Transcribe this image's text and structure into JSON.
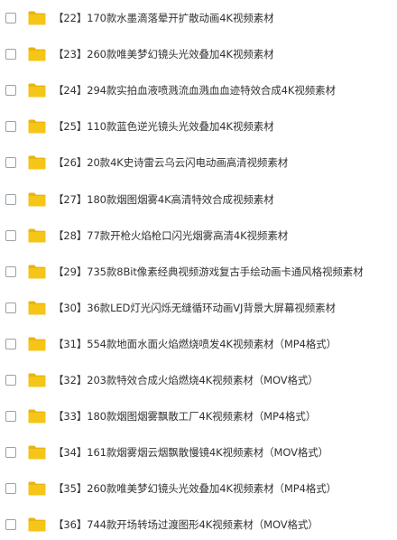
{
  "folder_color": "#F5C518",
  "folder_tab_color": "#E8B410",
  "text_color": "#333333",
  "icon": "folder-icon",
  "files": [
    {
      "name": "【22】170款水墨滴落晕开扩散动画4K视频素材"
    },
    {
      "name": "【23】260款唯美梦幻镜头光效叠加4K视频素材"
    },
    {
      "name": "【24】294款实拍血液喷溅流血溅血血迹特效合成4K视频素材"
    },
    {
      "name": "【25】110款蓝色逆光镜头光效叠加4K视频素材"
    },
    {
      "name": "【26】20款4K史诗雷云乌云闪电动画高清视频素材"
    },
    {
      "name": "【27】180款烟图烟雾4K高清特效合成视频素材"
    },
    {
      "name": "【28】77款开枪火焰枪口闪光烟雾高清4K视频素材"
    },
    {
      "name": "【29】735款8Bit像素经典视频游戏复古手绘动画卡通风格视频素材"
    },
    {
      "name": "【30】36款LED灯光闪烁无缝循环动画VJ背景大屏幕视频素材"
    },
    {
      "name": "【31】554款地面水面火焰燃烧喷发4K视频素材（MP4格式）"
    },
    {
      "name": "【32】203款特效合成火焰燃烧4K视频素材（MOV格式）"
    },
    {
      "name": "【33】180款烟图烟雾飘散工厂4K视频素材（MP4格式）"
    },
    {
      "name": "【34】161款烟雾烟云烟飘散慢镜4K视频素材（MOV格式）"
    },
    {
      "name": "【35】260款唯美梦幻镜头光效叠加4K视频素材（MP4格式）"
    },
    {
      "name": "【36】744款开场转场过渡图形4K视频素材（MOV格式）"
    }
  ]
}
